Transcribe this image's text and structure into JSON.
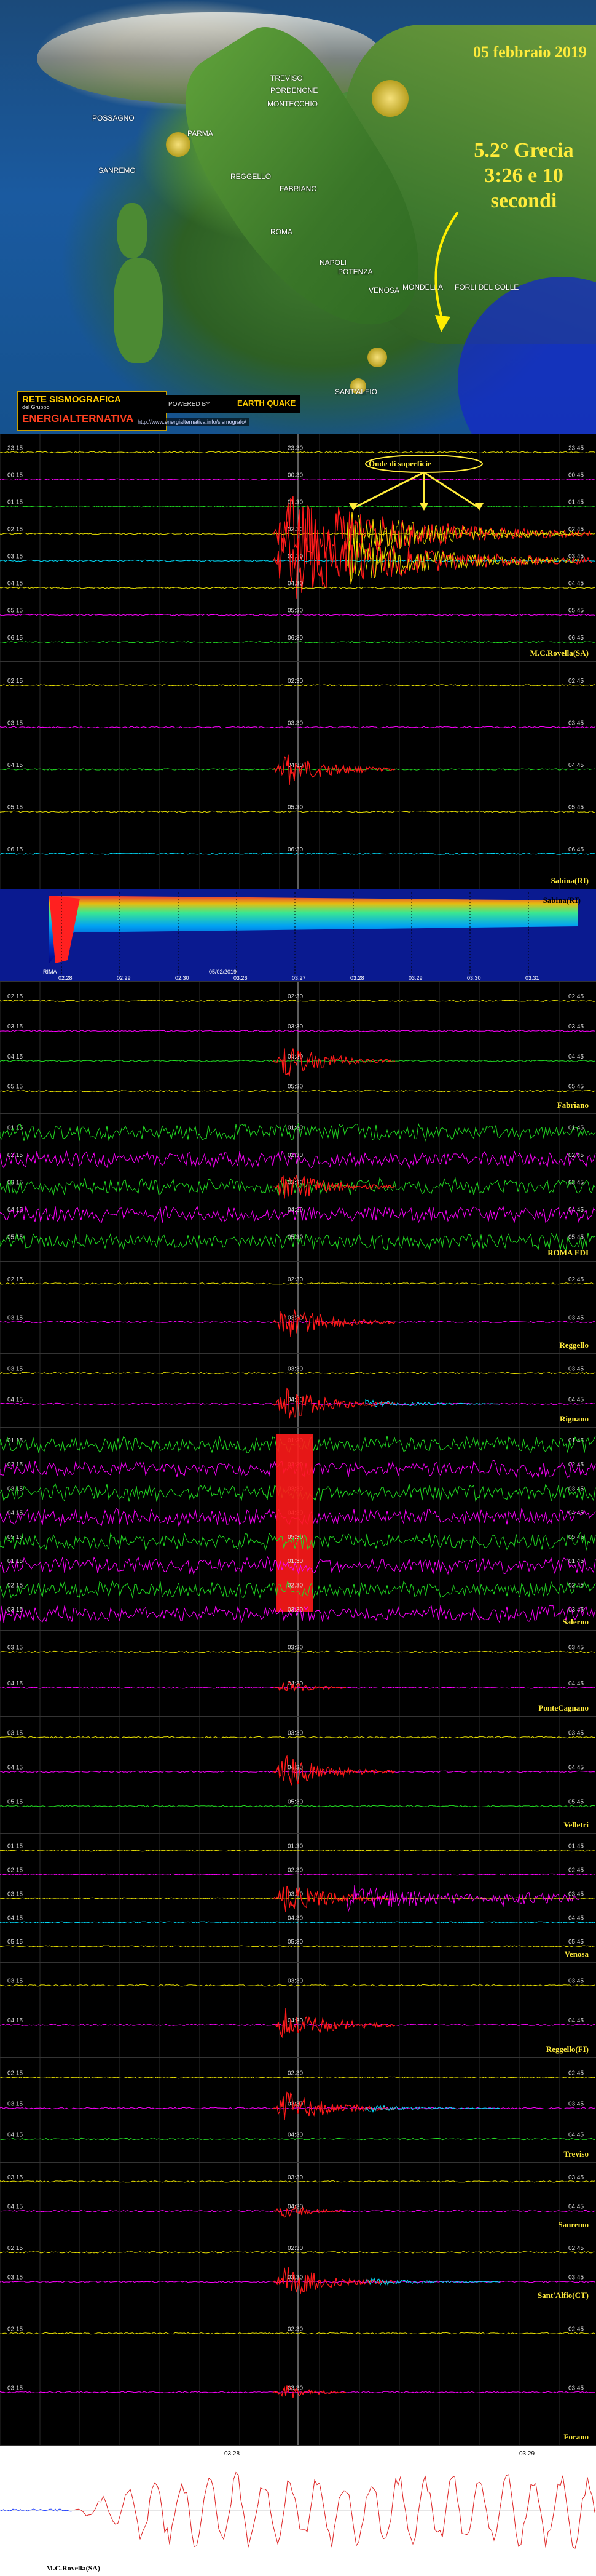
{
  "header": {
    "date": "05 febbraio 2019",
    "event_line1": "5.2° Grecia",
    "event_line2": "3:26 e 10 secondi",
    "logo_line1": "RETE SISMOGRAFICA",
    "logo_line2": "del Gruppo",
    "logo_line3": "ENERGIALTERNATIVA",
    "powered_by": "POWERED BY",
    "earthquake_logo": "EARTH QUAKE",
    "url": "http://www.energialternativa.info/sismografo/"
  },
  "cities": [
    "POSSAGNO",
    "PORDENONE",
    "MONTECCHIO",
    "PARMA",
    "SANREMO",
    "REGGELLO",
    "FABRIANO",
    "ROMA",
    "NAPOLI",
    "POTENZA",
    "VENOSA",
    "MONDELLA",
    "SANT'ALFIO",
    "TREVISO",
    "FORLI DEL COLLE"
  ],
  "annotation": "Onde di superficie",
  "colors": {
    "red": "#ff1a1a",
    "yellow": "#e8e000",
    "green": "#22dd22",
    "magenta": "#ff00ff",
    "cyan": "#00e0ff",
    "grid": "#444444"
  },
  "panels": [
    {
      "name": "M.C.Rovella(SA)",
      "times_left": [
        "23:15",
        "00:15",
        "01:15",
        "02:15",
        "03:15",
        "04:15",
        "05:15",
        "06:15"
      ],
      "times_mid": [
        "23:30",
        "00:30",
        "01:30",
        "02:30",
        "03:30",
        "04:30",
        "05:30",
        "06:30"
      ],
      "times_right": [
        "23:45",
        "00:45",
        "01:45",
        "02:45",
        "03:45",
        "04:45",
        "05:45",
        "06:45"
      ]
    },
    {
      "name": "Sabina(RI)",
      "times_left": [
        "02:15",
        "03:15",
        "04:15",
        "05:15",
        "06:15"
      ],
      "times_mid": [
        "02:30",
        "03:30",
        "04:30",
        "05:30",
        "06:30"
      ],
      "times_right": [
        "02:45",
        "03:45",
        "04:45",
        "05:45",
        "06:45"
      ]
    },
    {
      "name": "Fabriano",
      "times_left": [
        "02:15",
        "03:15",
        "04:15",
        "05:15"
      ],
      "times_mid": [
        "02:30",
        "03:30",
        "04:30",
        "05:30"
      ],
      "times_right": [
        "02:45",
        "03:45",
        "04:45",
        "05:45"
      ]
    },
    {
      "name": "ROMA EDI",
      "times_left": [
        "01:15",
        "02:15",
        "03:15",
        "04:15",
        "05:15"
      ],
      "times_mid": [
        "01:30",
        "02:30",
        "03:30",
        "04:30",
        "05:30"
      ],
      "times_right": [
        "01:45",
        "02:45",
        "03:45",
        "04:45",
        "05:45"
      ]
    },
    {
      "name": "Reggello",
      "times_left": [
        "02:15",
        "03:15"
      ],
      "times_mid": [
        "02:30",
        "03:30"
      ],
      "times_right": [
        "02:45",
        "03:45"
      ]
    },
    {
      "name": "Rignano",
      "times_left": [
        "03:15",
        "04:15"
      ],
      "times_mid": [
        "03:30",
        "04:30"
      ],
      "times_right": [
        "03:45",
        "04:45"
      ]
    },
    {
      "name": "Salerno",
      "times_left": [
        "01:15",
        "02:15",
        "03:15",
        "04:15",
        "05:15"
      ],
      "times_mid": [
        "01:30",
        "02:30",
        "03:30",
        "04:30",
        "05:30"
      ],
      "times_right": [
        "01:45",
        "02:45",
        "03:45",
        "04:45",
        "05:45"
      ]
    },
    {
      "name": "PonteCagnano",
      "times_left": [
        "03:15",
        "04:15"
      ],
      "times_mid": [
        "03:30",
        "04:30"
      ],
      "times_right": [
        "03:45",
        "04:45"
      ]
    },
    {
      "name": "Velletri",
      "times_left": [
        "03:15",
        "04:15",
        "05:15"
      ],
      "times_mid": [
        "03:30",
        "04:30",
        "05:30"
      ],
      "times_right": [
        "03:45",
        "04:45",
        "05:45"
      ]
    },
    {
      "name": "Venosa",
      "times_left": [
        "01:15",
        "02:15",
        "03:15",
        "04:15",
        "05:15"
      ],
      "times_mid": [
        "01:30",
        "02:30",
        "03:30",
        "04:30",
        "05:30"
      ],
      "times_right": [
        "01:45",
        "02:45",
        "03:45",
        "04:45",
        "05:45"
      ]
    },
    {
      "name": "Reggello(FI)",
      "times_left": [
        "03:15",
        "04:15"
      ],
      "times_mid": [
        "03:30",
        "04:30"
      ],
      "times_right": [
        "03:45",
        "04:45"
      ]
    },
    {
      "name": "Treviso",
      "times_left": [
        "02:15",
        "03:15",
        "04:15"
      ],
      "times_mid": [
        "02:30",
        "03:30",
        "04:30"
      ],
      "times_right": [
        "02:45",
        "03:45",
        "04:45"
      ]
    },
    {
      "name": "Sanremo",
      "times_left": [
        "03:15",
        "04:15"
      ],
      "times_mid": [
        "03:30",
        "04:30"
      ],
      "times_right": [
        "03:45",
        "04:45"
      ]
    },
    {
      "name": "Sant'Alfio(CT)",
      "times_left": [
        "02:15",
        "03:15"
      ],
      "times_mid": [
        "02:30",
        "03:30"
      ],
      "times_right": [
        "02:45",
        "03:45"
      ]
    },
    {
      "name": "Forano",
      "times_left": [
        "02:15",
        "03:15"
      ],
      "times_mid": [
        "02:30",
        "03:30"
      ],
      "times_right": [
        "02:45",
        "03:45"
      ]
    }
  ],
  "spectrogram": {
    "station": "Sabina(RI)",
    "label": "RIMA",
    "date": "05/02/2019",
    "times": [
      "02:28",
      "02:29",
      "02:30",
      "03:26",
      "03:27",
      "03:28",
      "03:29",
      "03:30",
      "03:31"
    ]
  },
  "zoom": {
    "station": "M.C.Rovella(SA)",
    "times": [
      "03:28",
      "03:29"
    ]
  }
}
